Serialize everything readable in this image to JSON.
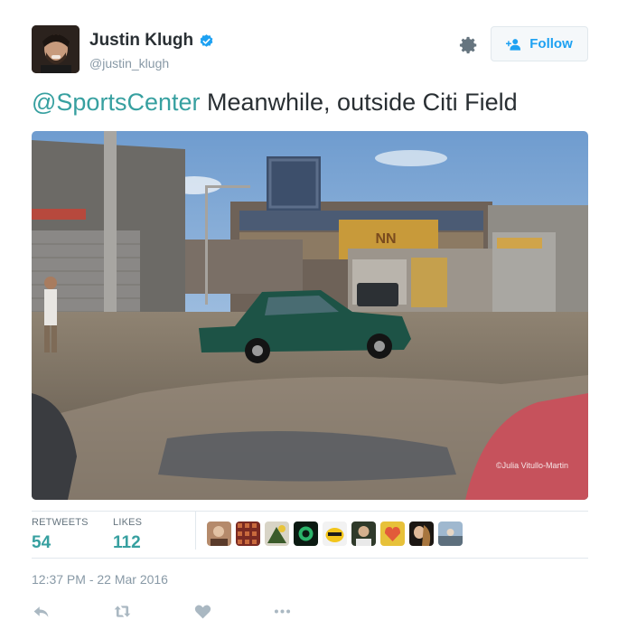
{
  "user": {
    "full_name": "Justin Klugh",
    "handle": "@justin_klugh",
    "verified": true
  },
  "header": {
    "follow_label": "Follow"
  },
  "tweet": {
    "mention": "@SportsCenter",
    "text": " Meanwhile, outside Citi Field",
    "photo_credit": "©Julia Vitullo-Martin"
  },
  "stats": {
    "retweets_label": "RETWEETS",
    "retweets_count": "54",
    "likes_label": "LIKES",
    "likes_count": "112"
  },
  "timestamp": "12:37 PM - 22 Mar 2016",
  "colors": {
    "accent_teal": "#37a0a0",
    "follow_blue": "#1da1f2",
    "muted": "#8899a6",
    "divider": "#e1e8ed"
  },
  "icons": [
    "verified-badge-icon",
    "gear-icon",
    "follow-plus-icon",
    "reply-icon",
    "retweet-icon",
    "like-heart-icon",
    "more-dots-icon"
  ]
}
